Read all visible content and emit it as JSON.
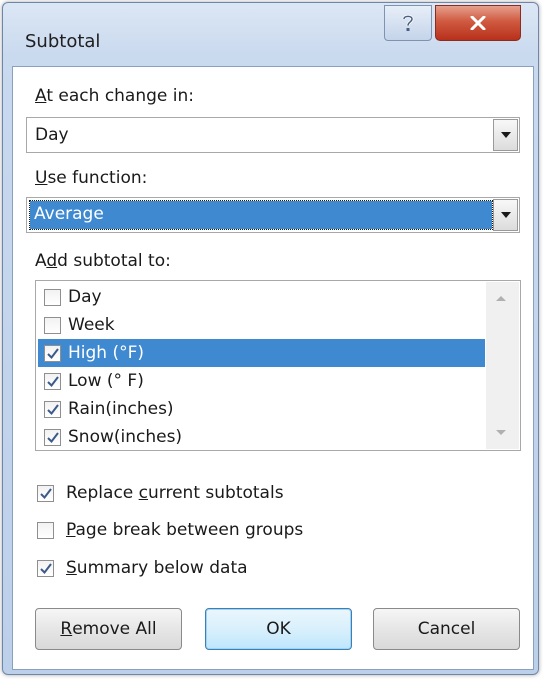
{
  "dialog": {
    "title": "Subtotal",
    "help_symbol": "?",
    "close_symbol": "x"
  },
  "change_in": {
    "label_accel": "A",
    "label_rest": "t each change in:",
    "value": "Day"
  },
  "function": {
    "label_accel": "U",
    "label_rest": "se function:",
    "value": "Average"
  },
  "add_to": {
    "label_pre": "A",
    "label_accel": "d",
    "label_rest": "d subtotal to:",
    "items": [
      {
        "label": "Day",
        "checked": false,
        "selected": false
      },
      {
        "label": "Week",
        "checked": false,
        "selected": false
      },
      {
        "label": "High (°F)",
        "checked": true,
        "selected": true
      },
      {
        "label": "Low (° F)",
        "checked": true,
        "selected": false
      },
      {
        "label": "Rain(inches)",
        "checked": true,
        "selected": false
      },
      {
        "label": "Snow(inches)",
        "checked": true,
        "selected": false
      }
    ]
  },
  "options": {
    "replace": {
      "pre": "Replace ",
      "accel": "c",
      "rest": "urrent subtotals",
      "checked": true
    },
    "page_break": {
      "pre": "",
      "accel": "P",
      "rest": "age break between groups",
      "checked": false
    },
    "summary": {
      "pre": "",
      "accel": "S",
      "rest": "ummary below data",
      "checked": true
    }
  },
  "buttons": {
    "remove_all": {
      "accel": "R",
      "rest": "emove All"
    },
    "ok": "OK",
    "cancel": "Cancel"
  },
  "colors": {
    "selection": "#3f89d0",
    "close_button": "#c7432b",
    "frame": "#c9d9ee"
  }
}
